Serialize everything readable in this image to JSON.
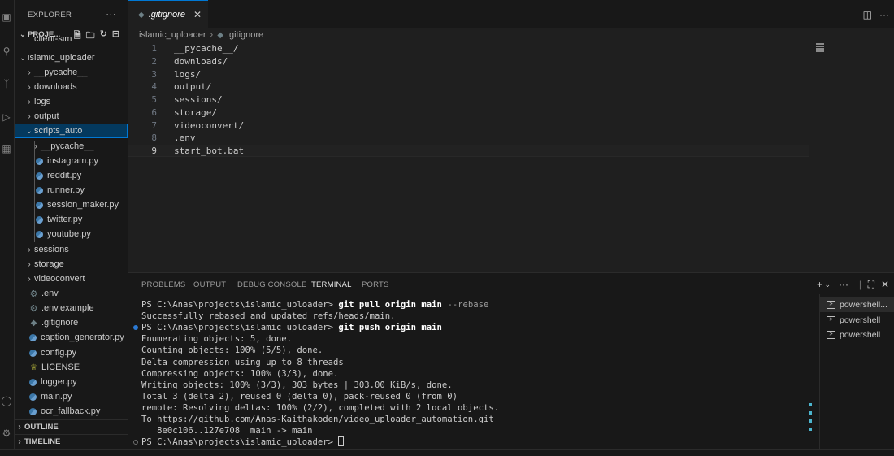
{
  "sidebar": {
    "title": "EXPLORER",
    "project_label": "PROJE...",
    "items": [
      {
        "label": "client-sim",
        "kind": "plain"
      },
      {
        "label": "islamic_uploader",
        "kind": "folder-open"
      },
      {
        "label": "__pycache__",
        "kind": "folder"
      },
      {
        "label": "downloads",
        "kind": "folder"
      },
      {
        "label": "logs",
        "kind": "folder"
      },
      {
        "label": "output",
        "kind": "folder"
      },
      {
        "label": "scripts_auto",
        "kind": "folder-open"
      },
      {
        "label": "__pycache__",
        "kind": "folder"
      },
      {
        "label": "instagram.py",
        "kind": "py"
      },
      {
        "label": "reddit.py",
        "kind": "py"
      },
      {
        "label": "runner.py",
        "kind": "py"
      },
      {
        "label": "session_maker.py",
        "kind": "py"
      },
      {
        "label": "twitter.py",
        "kind": "py"
      },
      {
        "label": "youtube.py",
        "kind": "py"
      },
      {
        "label": "sessions",
        "kind": "folder"
      },
      {
        "label": "storage",
        "kind": "folder"
      },
      {
        "label": "videoconvert",
        "kind": "folder"
      },
      {
        "label": ".env",
        "kind": "gear"
      },
      {
        "label": ".env.example",
        "kind": "gear"
      },
      {
        "label": ".gitignore",
        "kind": "git"
      },
      {
        "label": "caption_generator.py",
        "kind": "py"
      },
      {
        "label": "config.py",
        "kind": "py"
      },
      {
        "label": "LICENSE",
        "kind": "license"
      },
      {
        "label": "logger.py",
        "kind": "py"
      },
      {
        "label": "main.py",
        "kind": "py"
      },
      {
        "label": "ocr_fallback.py",
        "kind": "py"
      }
    ],
    "outline_label": "OUTLINE",
    "timeline_label": "TIMELINE"
  },
  "editor": {
    "tab_label": ".gitignore",
    "breadcrumb": [
      "islamic_uploader",
      ".gitignore"
    ],
    "lines": [
      {
        "n": "1",
        "text": "__pycache__/"
      },
      {
        "n": "2",
        "text": "downloads/"
      },
      {
        "n": "3",
        "text": "logs/"
      },
      {
        "n": "4",
        "text": "output/"
      },
      {
        "n": "5",
        "text": "sessions/"
      },
      {
        "n": "6",
        "text": "storage/"
      },
      {
        "n": "7",
        "text": "videoconvert/"
      },
      {
        "n": "8",
        "text": ".env"
      },
      {
        "n": "9",
        "text": "start_bot.bat"
      }
    ]
  },
  "panel": {
    "tabs": [
      "PROBLEMS",
      "OUTPUT",
      "DEBUG CONSOLE",
      "TERMINAL",
      "PORTS"
    ],
    "active_tab": "TERMINAL",
    "terminal_lines": [
      {
        "prompt": "PS C:\\Anas\\projects\\islamic_uploader> ",
        "cmd": "git pull origin main",
        "flag": " --rebase",
        "dot": "none"
      },
      {
        "text": "Successfully rebased and updated refs/heads/main."
      },
      {
        "prompt": "PS C:\\Anas\\projects\\islamic_uploader> ",
        "cmd": "git push origin main",
        "flag": "",
        "dot": "ok"
      },
      {
        "text": "Enumerating objects: 5, done."
      },
      {
        "text": "Counting objects: 100% (5/5), done."
      },
      {
        "text": "Delta compression using up to 8 threads"
      },
      {
        "text": "Compressing objects: 100% (3/3), done."
      },
      {
        "text": "Writing objects: 100% (3/3), 303 bytes | 303.00 KiB/s, done."
      },
      {
        "text": "Total 3 (delta 2), reused 0 (delta 0), pack-reused 0 (from 0)"
      },
      {
        "text": "remote: Resolving deltas: 100% (2/2), completed with 2 local objects."
      },
      {
        "text": "To https://github.com/Anas-Kaithakoden/video_uploader_automation.git"
      },
      {
        "text": "   8e0c106..127e708  main -> main"
      },
      {
        "prompt": "PS C:\\Anas\\projects\\islamic_uploader> ",
        "cmd": "",
        "flag": "",
        "dot": "idle",
        "cursor": true
      }
    ],
    "terminals": [
      "powershell...",
      "powershell",
      "powershell"
    ]
  },
  "colors": {
    "accent": "#0078d4",
    "selection": "#04395e",
    "editor_bg": "#1f1f1f",
    "chrome_bg": "#181818"
  }
}
